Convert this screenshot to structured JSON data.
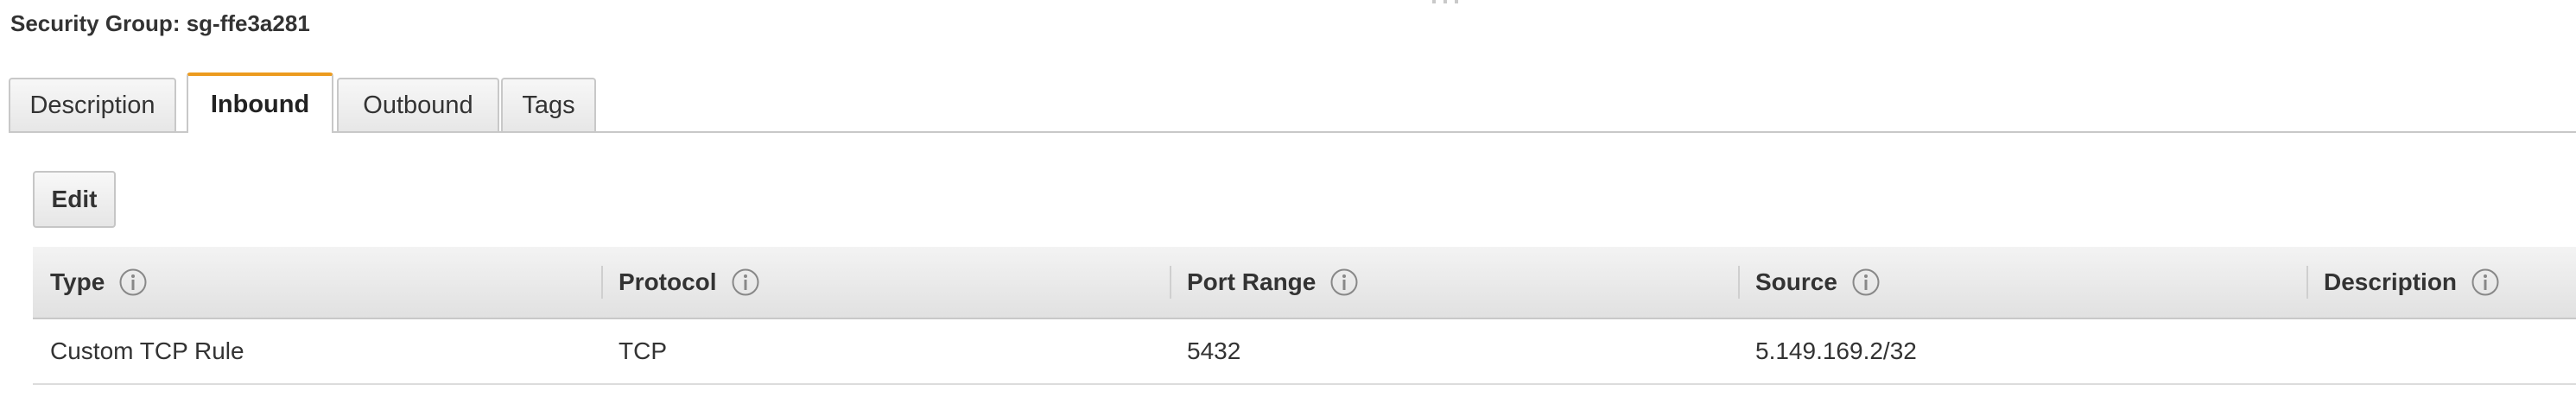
{
  "header": {
    "title": "Security Group: sg-ffe3a281"
  },
  "tabs": [
    {
      "label": "Description",
      "active": false
    },
    {
      "label": "Inbound",
      "active": true
    },
    {
      "label": "Outbound",
      "active": false
    },
    {
      "label": "Tags",
      "active": false
    }
  ],
  "toolbar": {
    "edit_label": "Edit"
  },
  "table": {
    "columns": [
      "Type",
      "Protocol",
      "Port Range",
      "Source",
      "Description"
    ],
    "rows": [
      {
        "type": "Custom TCP Rule",
        "protocol": "TCP",
        "port_range": "5432",
        "source": "5.149.169.2/32",
        "description": ""
      }
    ]
  },
  "colors": {
    "active_tab_accent": "#ec9b1f",
    "info_icon": "#888888"
  },
  "icons": {
    "info": "info-circle-icon"
  }
}
